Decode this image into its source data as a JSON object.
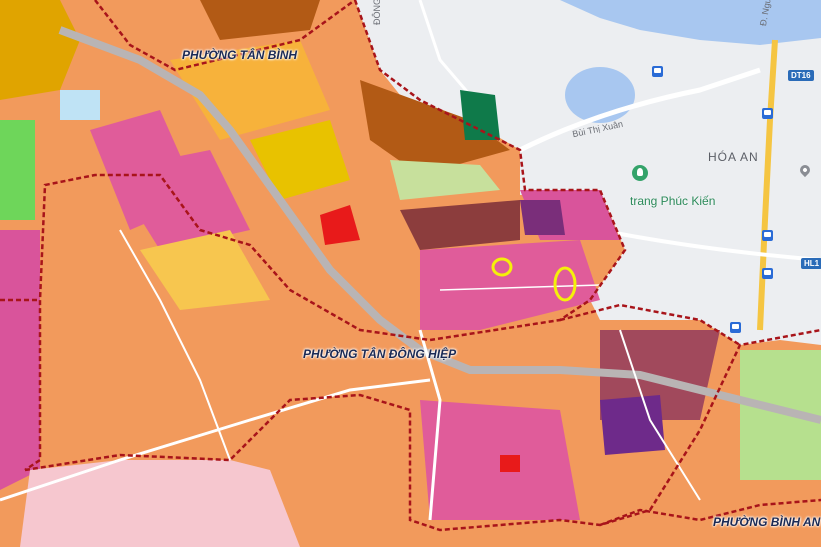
{
  "ward_labels": {
    "tan_binh": "PHƯỜNG TÂN BÌNH",
    "tan_dong_hiep": "PHƯỜNG TÂN ĐÔNG HIỆP",
    "binh_an": "PHƯỜNG BÌNH AN"
  },
  "place_labels": {
    "hoa_an": "HÓA AN"
  },
  "poi_labels": {
    "trang_phuc_kien": "trang Phúc Kiến"
  },
  "road_labels": {
    "bui_thi_xuan": "Bùi Thị Xuân",
    "nguyen_ai": "Đ. Nguyễn Ái",
    "dong": "ĐÔNG"
  },
  "route_shields": {
    "dt16": "DT16",
    "hl1": "HL1"
  },
  "icons": [
    "bus-stop-icon",
    "park-icon",
    "location-pin-icon"
  ],
  "colors": {
    "residential": "#f08a4b",
    "commercial": "#e055a0",
    "public": "#f2c94c",
    "green": "#7ed957",
    "industrial_dark": "#7a2e7a",
    "boundary": "#b01c1c",
    "highlight": "#f4f00a"
  }
}
